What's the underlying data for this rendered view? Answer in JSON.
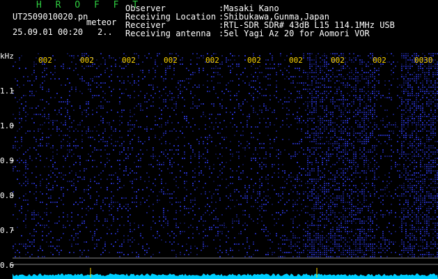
{
  "header": {
    "app_letters": "H R O F F T",
    "filename": "UT2509010020.pn",
    "meteor_label": "meteor",
    "datetime": "25.09.01 00:20",
    "count": "2..",
    "info": [
      {
        "label": "Observer",
        "value": ":Masaki Kano"
      },
      {
        "label": "Receiving Location",
        "value": ":Shibukawa,Gunma,Japan"
      },
      {
        "label": "Receiver",
        "value": ":RTL-SDR SDR# 43dB L15 114.1MHz USB"
      },
      {
        "label": "Receiving antenna",
        "value": ":5el Yagi Az 20 for Aomori VOR"
      }
    ]
  },
  "spectrogram": {
    "y_unit": "kHz",
    "y_ticks": [
      "1.1",
      "1.0",
      "0.9",
      "0.8",
      "0.7",
      "0.6"
    ],
    "time_labels": [
      "002",
      "002",
      "002",
      "002",
      "002",
      "002",
      "002",
      "002",
      "002",
      "0030"
    ],
    "colors": {
      "background": "#000000",
      "signal": "#2233cc",
      "time_label": "#ffd700",
      "baseline": "#00d0ff",
      "marker": "#ffd700"
    }
  }
}
